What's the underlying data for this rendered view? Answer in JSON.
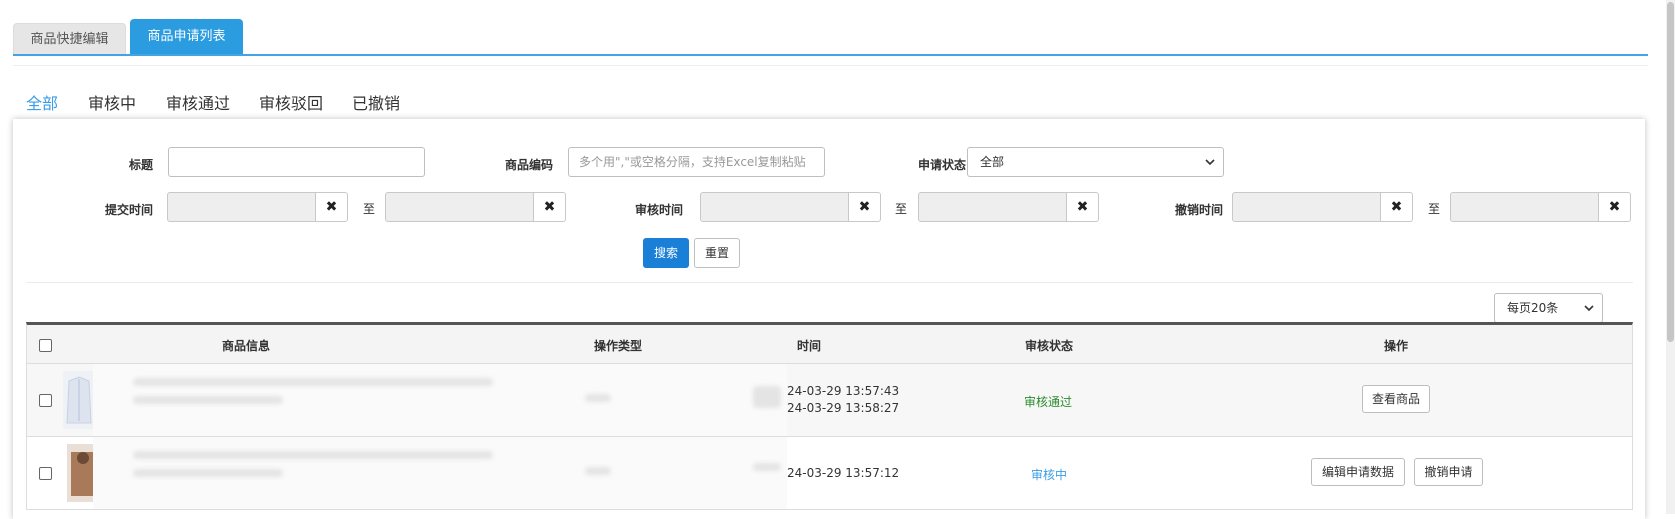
{
  "top_tabs": [
    {
      "label": "商品快捷编辑",
      "active": false
    },
    {
      "label": "商品申请列表",
      "active": true
    }
  ],
  "status_tabs": [
    {
      "label": "全部",
      "selected": true
    },
    {
      "label": "审核中",
      "selected": false
    },
    {
      "label": "审核通过",
      "selected": false
    },
    {
      "label": "审核驳回",
      "selected": false
    },
    {
      "label": "已撤销",
      "selected": false
    }
  ],
  "filters": {
    "title_label": "标题",
    "code_label": "商品编码",
    "code_placeholder": "多个用\",\"或空格分隔，支持Excel复制粘贴",
    "status_label": "申请状态",
    "status_value": "全部",
    "submit_time_label": "提交时间",
    "review_time_label": "审核时间",
    "cancel_time_label": "撤销时间",
    "to_label": "至",
    "clear_icon": "✖",
    "search_label": "搜索",
    "reset_label": "重置"
  },
  "page_size": {
    "value": "每页20条"
  },
  "table": {
    "headers": {
      "info": "商品信息",
      "op_type": "操作类型",
      "time": "时间",
      "status": "审核状态",
      "actions": "操作"
    },
    "rows": [
      {
        "time1": "24-03-29 13:57:43",
        "time2": "24-03-29 13:58:27",
        "status": "审核通过",
        "actions": [
          "查看商品"
        ]
      },
      {
        "time1": "24-03-29 13:57:12",
        "status": "审核中",
        "actions": [
          "编辑申请数据",
          "撤销申请"
        ]
      }
    ]
  },
  "colors": {
    "accent": "#2b9ce0",
    "primary_button": "#1a7fd6",
    "status_ok": "#2e8b2e",
    "status_pending": "#3a9de6"
  }
}
